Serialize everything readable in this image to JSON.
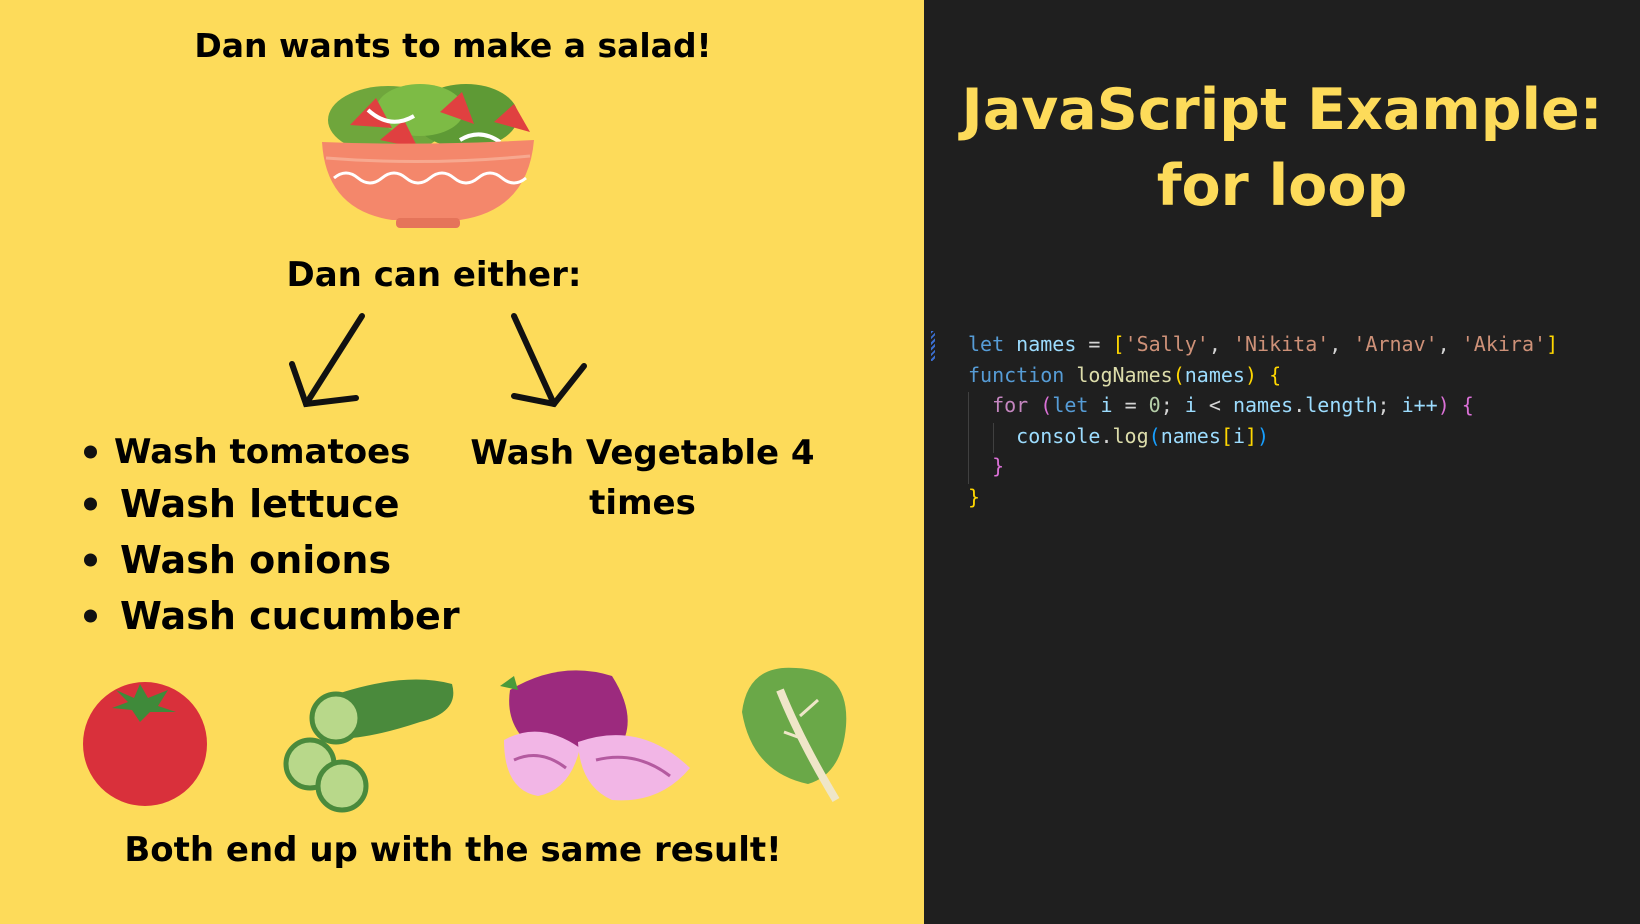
{
  "left_panel": {
    "title": "Dan wants to make a salad!",
    "either": "Dan can either:",
    "bullets": [
      "Wash tomatoes",
      "Wash lettuce",
      "Wash onions",
      "Wash cucumber"
    ],
    "option_b": "Wash Vegetable 4 times",
    "result": "Both end up with the same result!",
    "background": "#fddb5a"
  },
  "right_panel": {
    "title_line1": "JavaScript Example:",
    "title_line2": "for loop",
    "title_color": "#fddb5a",
    "background": "#1f1f1f",
    "code": {
      "line1": {
        "kw": "let",
        "var": "names",
        "eq": " = ",
        "open": "[",
        "s1": "'Sally'",
        "s2": "'Nikita'",
        "s3": "'Arnav'",
        "s4": "'Akira'",
        "close": "]"
      },
      "line2": {
        "kw": "function",
        "fn": "logNames",
        "open": "(",
        "param": "names",
        "close": ")",
        "brace": "{"
      },
      "line3": {
        "kw": "for",
        "open": "(",
        "let": "let",
        "i": "i",
        "eq": " = ",
        "zero": "0",
        "semi": "; ",
        "i2": "i",
        "lt": " < ",
        "names": "names",
        "dot": ".",
        "len": "length",
        "semi2": "; ",
        "inc": "i++",
        "close": ")",
        "brace": "{"
      },
      "line4": {
        "console": "console",
        "dot": ".",
        "log": "log",
        "open": "(",
        "names": "names",
        "ob": "[",
        "i": "i",
        "cb": "]",
        "close": ")"
      },
      "line5": {
        "brace": "}"
      },
      "line6": {
        "brace": "}"
      }
    }
  }
}
